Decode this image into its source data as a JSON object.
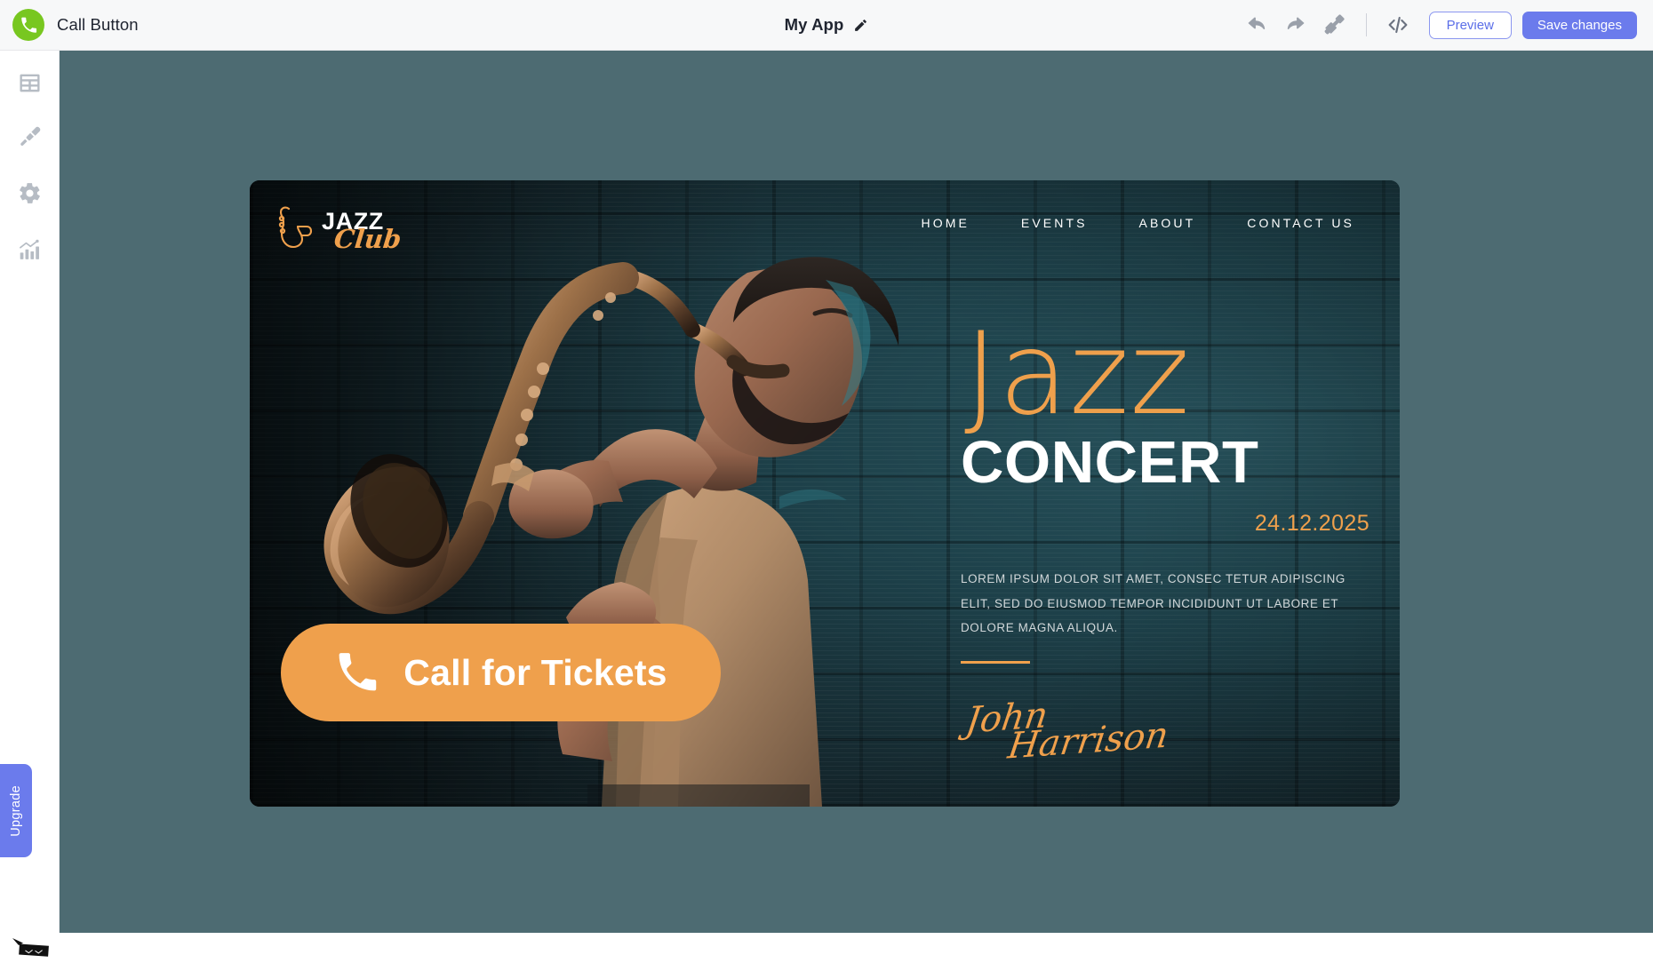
{
  "topbar": {
    "brand_icon": "phone-icon",
    "brand_title": "Call Button",
    "app_name": "My App",
    "edit_icon": "pencil-icon",
    "tools": [
      {
        "icon": "undo-icon",
        "name": "undo-button"
      },
      {
        "icon": "redo-icon",
        "name": "redo-button"
      },
      {
        "icon": "paint-roller-icon",
        "name": "paint-roller-button"
      }
    ],
    "code_icon": "code-icon",
    "preview_label": "Preview",
    "save_label": "Save changes",
    "accent_purple": "#6b7bec",
    "brand_green": "#78c720"
  },
  "sidebar": {
    "items": [
      {
        "icon": "layout-grid-icon",
        "name": "sidebar-item-layout"
      },
      {
        "icon": "paint-brush-icon",
        "name": "sidebar-item-design"
      },
      {
        "icon": "gear-icon",
        "name": "sidebar-item-settings"
      },
      {
        "icon": "analytics-chart-icon",
        "name": "sidebar-item-analytics"
      }
    ],
    "upgrade_label": "Upgrade"
  },
  "canvas": {
    "background_color": "#4d6b72"
  },
  "hero": {
    "logo": {
      "mark": "saxophone-icon",
      "word_top": "JAZZ",
      "word_bottom": "Club"
    },
    "nav": [
      {
        "label": "HOME"
      },
      {
        "label": "EVENTS"
      },
      {
        "label": "ABOUT"
      },
      {
        "label": "CONTACT US"
      }
    ],
    "title_script": "Jazz",
    "title_bold": "CONCERT",
    "date": "24.12.2025",
    "body": "LOREM IPSUM DOLOR SIT AMET, CONSEC TETUR ADIPISCING ELIT, SED DO EIUSMOD TEMPOR INCIDIDUNT UT LABORE ET DOLORE MAGNA ALIQUA.",
    "signature_line1": "John",
    "signature_line2": "Harrison",
    "cta_icon": "phone-icon",
    "cta_label": "Call for Tickets",
    "accent_orange": "#efa04c",
    "wall_color": "#1e3a42"
  }
}
